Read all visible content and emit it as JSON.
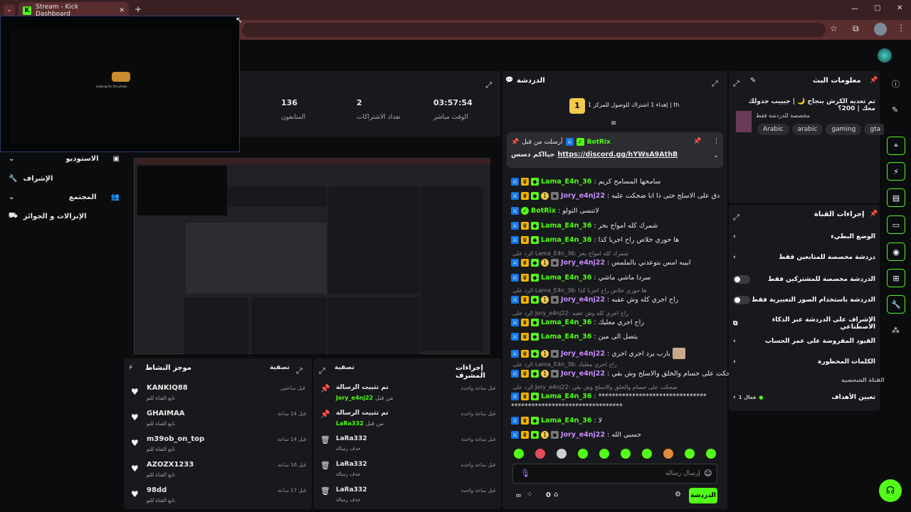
{
  "browser": {
    "tab_title": "Stream - Kick Dashboard",
    "new_tab": "+",
    "close": "✕",
    "min": "—",
    "max": "▢",
    "winclose": "✕"
  },
  "stats": {
    "followers_value": "136",
    "followers_label": "المتابعون",
    "subs_value": "2",
    "subs_label": "تعداد الاشتراكات",
    "live_value": "03:57:54",
    "live_label": "الوقت مباشر"
  },
  "preview": {
    "loading_text": "Looking for the phase"
  },
  "left_nav": {
    "items": [
      {
        "label": "الاستوديو"
      },
      {
        "label": "الإشراف"
      },
      {
        "label": "المجتمع"
      },
      {
        "label": "الإنزالات و الجوائز"
      }
    ]
  },
  "activity": {
    "title": "موجز النشاط",
    "filter": "تصفية",
    "items": [
      {
        "name": "KANKIQ88",
        "sub": "تابع القناة للتو",
        "time": "قبل ساعتين"
      },
      {
        "name": "GHAIMAA",
        "sub": "تابع القناة للتو",
        "time": "قبل 14 ساعة"
      },
      {
        "name": "m39ob_on_top",
        "sub": "تابع القناة للتو",
        "time": "قبل 14 ساعة"
      },
      {
        "name": "AZOZX1233",
        "sub": "تابع القناة للتو",
        "time": "قبل 16 ساعة"
      },
      {
        "name": "98dd",
        "sub": "تابع القناة للتو",
        "time": "قبل 17 ساعة"
      }
    ]
  },
  "modactions": {
    "title": "إجراءات المشرف",
    "filter": "تصفية",
    "items": [
      {
        "title": "تم تثبيت الرسالة",
        "by_prefix": "من قبل",
        "by": "Jory_e4nj22",
        "time": "قبل ساعة واحدة"
      },
      {
        "title": "تم تثبيت الرسالة",
        "by_prefix": "من قبل",
        "by": "LaRa332",
        "time": "قبل ساعة واحدة"
      },
      {
        "title": "LaRa332",
        "sub": "حذف رسالة",
        "time": "قبل ساعة واحدة"
      },
      {
        "title": "LaRa332",
        "sub": "حذف رسالة",
        "time": "قبل ساعة واحدة"
      },
      {
        "title": "LaRa332",
        "sub": "حذف رسالة",
        "time": "قبل ساعة واحدة"
      }
    ]
  },
  "chat": {
    "title": "الدردشة",
    "gift_text": "إهداء 1 اشتراك للوصول للمركز 1 | th",
    "gift_rank": "1",
    "pinned_prefix": "أرسلت من قبل",
    "pinned_user": "BotRix",
    "pinned_text": "حيااكم دسس",
    "pinned_link": "https://discord.gg/hYWsA9AthB",
    "messages": [
      {
        "user": "Lama_E4n_36",
        "color": "green",
        "badges": [
          "mod",
          "crown",
          "sub"
        ],
        "text": "سامحها المسامح كريم"
      },
      {
        "user": "Jory_e4nj22",
        "color": "purple",
        "badges": [
          "mod",
          "crown",
          "sub",
          "one",
          "chip"
        ],
        "text": "دق على الاسلح حتى ذا انا ضحكت عليه"
      },
      {
        "user": "BotRix",
        "color": "green",
        "badges": [
          "mod",
          "verified"
        ],
        "text": "لاتنسى التولو"
      },
      {
        "user": "Lama_E4n_36",
        "color": "green",
        "badges": [
          "mod",
          "crown",
          "sub"
        ],
        "text": "شمرك كله امواج بحر"
      },
      {
        "user": "Lama_E4n_36",
        "color": "green",
        "badges": [
          "mod",
          "crown",
          "sub"
        ],
        "text": "ها حوري خلاص راح اجربا كذا"
      },
      {
        "reply": "الرد على Lama_E4n_36: شمرك كله امواج بحر"
      },
      {
        "user": "Jory_e4nj22",
        "color": "purple",
        "badges": [
          "mod",
          "crown",
          "sub",
          "one",
          "chip"
        ],
        "text": "ابيبه امس بتوعدني بالملمس"
      },
      {
        "user": "Lama_E4n_36",
        "color": "green",
        "badges": [
          "mod",
          "crown",
          "sub"
        ],
        "text": "سردا ماشي ماشي"
      },
      {
        "reply": "الرد على Lama_E4n_36: ها حوري خلاص راح اجربا كذا"
      },
      {
        "user": "Jory_e4nj22",
        "color": "purple",
        "badges": [
          "mod",
          "crown",
          "sub",
          "one",
          "chip"
        ],
        "text": "راح اجري كله وش عقبه"
      },
      {
        "reply": "الرد على Jory_e4nj22: راح اجري كله وش عقبه"
      },
      {
        "user": "Lama_E4n_36",
        "color": "green",
        "badges": [
          "mod",
          "crown",
          "sub"
        ],
        "text": "راح اجري معليك"
      },
      {
        "user": "Lama_E4n_36",
        "color": "green",
        "badges": [
          "mod",
          "crown",
          "sub"
        ],
        "text": "يتصل الى مين"
      },
      {
        "user": "Jory_e4nj22",
        "color": "purple",
        "badges": [
          "mod",
          "crown",
          "sub",
          "one",
          "chip"
        ],
        "text": "يارب يرد اجري اجري"
      },
      {
        "reply": "الرد على Lama_E4n_36: راح اجري معليك"
      },
      {
        "user": "Jory_e4nj22",
        "color": "purple",
        "badges": [
          "mod",
          "crown",
          "sub",
          "one",
          "chip"
        ],
        "text": "ضحكت على حسام والخلق والاسلح وش بقي"
      },
      {
        "reply": "الرد على Jory_e4nj22: ضحكت على حسام والخلق والاسلح وش بقي"
      },
      {
        "user": "Lama_E4n_36",
        "color": "green",
        "badges": [
          "mod",
          "crown",
          "sub"
        ],
        "text": "********************************"
      },
      {
        "cont": "*********************************"
      },
      {
        "user": "Lama_E4n_36",
        "color": "green",
        "badges": [
          "mod",
          "crown",
          "sub"
        ],
        "text": "لا"
      },
      {
        "user": "Jory_e4nj22",
        "color": "purple",
        "badges": [
          "mod",
          "crown",
          "sub",
          "one",
          "chip"
        ],
        "text": "حسبي الله"
      }
    ],
    "input_placeholder": "إرسال رسالة",
    "send_label": "الدردشة",
    "viewers_count": "0"
  },
  "stream_info": {
    "title": "معلومات البث",
    "stream_title": "تم تعديه الكرش بنجاح 🌙 | جيييب جدولك معك | 200؟",
    "category": "مخصصة للدردشة فقط",
    "tags": [
      "gta",
      "gaming",
      "arabic",
      "Arabic"
    ]
  },
  "channel_actions": {
    "title": "إجراءات القناة",
    "rows": [
      {
        "label": "الوضع البطيء",
        "control": "chevron"
      },
      {
        "label": "دردشة مخصصة للمتابعين فقط",
        "control": "chevron"
      },
      {
        "label": "الدردشة مخصصة للمشتركين فقط",
        "control": "toggle"
      },
      {
        "label": "الدردشة باستخدام الصور التعبيرية فقط",
        "control": "toggle"
      },
      {
        "label": "الإشراف على الدردشة عبر الذكاء الاصطناعي",
        "control": "external"
      },
      {
        "label": "القيود المفروضة على عمر الحساب",
        "control": "chevron"
      },
      {
        "label": "الكلمات المحظورة",
        "control": "chevron"
      }
    ],
    "section_label": "القناة الشخصية",
    "goals_label": "تعيين الأهداف",
    "goals_status": "فعال 1"
  },
  "colors": {
    "accent": "#53fc18",
    "panel": "#18191c",
    "bg": "#0b0c0e"
  }
}
